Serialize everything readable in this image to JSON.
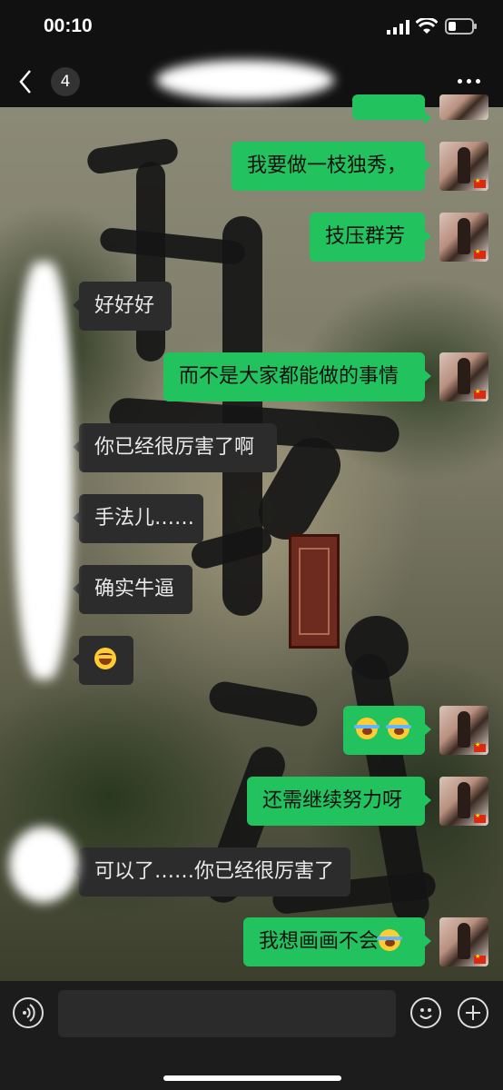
{
  "status_bar": {
    "time": "00:10"
  },
  "nav": {
    "back_count": "4",
    "more_icon": "more-dots-icon"
  },
  "messages": [
    {
      "side": "out",
      "text": "我要做一枝独秀，"
    },
    {
      "side": "out",
      "text": "技压群芳"
    },
    {
      "side": "in",
      "text": "好好好"
    },
    {
      "side": "out",
      "text": "而不是大家都能做的事情"
    },
    {
      "side": "in",
      "text": "你已经很厉害了啊"
    },
    {
      "side": "in",
      "text": "手法儿……"
    },
    {
      "side": "in",
      "text": "确实牛逼"
    },
    {
      "side": "in",
      "emoji": "grinning-face-icon"
    },
    {
      "side": "out",
      "emoji": "rolling-laughing-icon x2"
    },
    {
      "side": "out",
      "text": "还需继续努力呀"
    },
    {
      "side": "in",
      "text": "可以了……你已经很厉害了"
    },
    {
      "side": "out",
      "text": "我想画画不会"
    }
  ],
  "colors": {
    "outgoing_bubble": "#22c35e",
    "incoming_bubble": "#2c2c2c",
    "bar_background": "#111111"
  },
  "input_bar": {
    "value": "",
    "voice_icon": "voice-icon",
    "emoji_icon": "emoji-icon",
    "plus_icon": "plus-icon"
  }
}
